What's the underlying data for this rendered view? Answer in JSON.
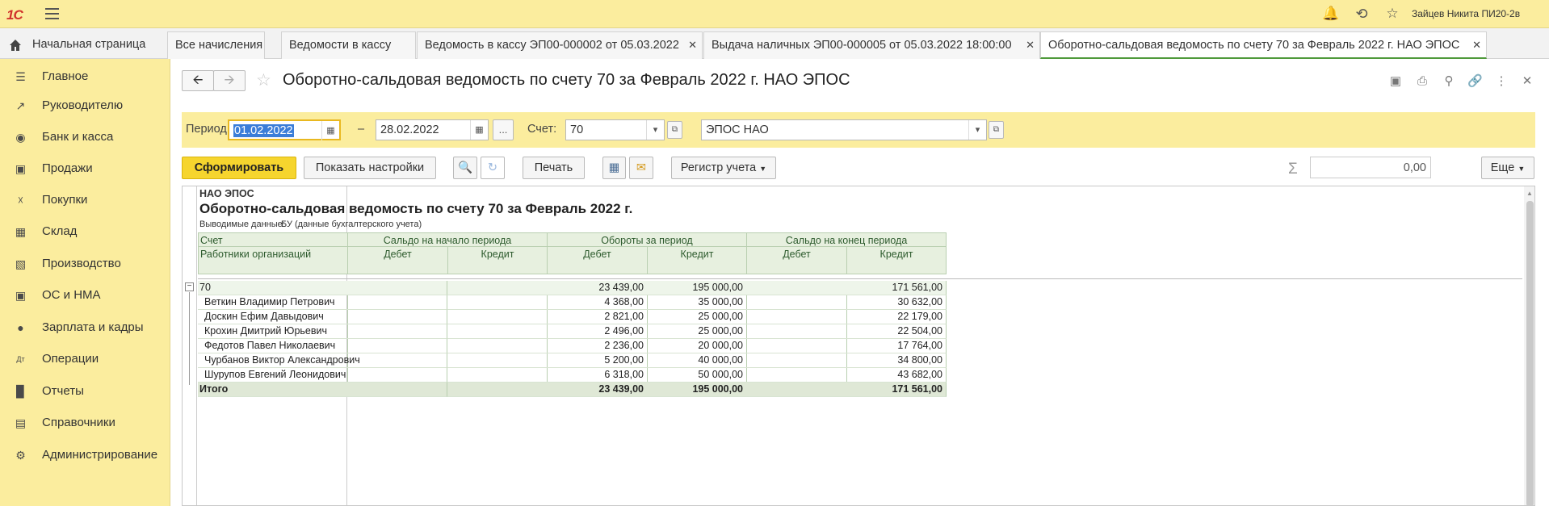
{
  "topbar": {
    "logo": "1С",
    "user_name": "Зайцев Никита ПИ20-2в",
    "icons": [
      "bell-icon",
      "history-icon",
      "star-icon"
    ]
  },
  "tabs": {
    "home": "Начальная страница",
    "items": [
      {
        "label": "Все начисления",
        "closable": false
      },
      {
        "label": "Ведомости в кассу",
        "closable": false
      },
      {
        "label": "Ведомость в кассу ЭП00-000002 от 05.03.2022",
        "closable": true
      },
      {
        "label": "Выдача наличных ЭП00-000005 от 05.03.2022 18:00:00",
        "closable": true
      },
      {
        "label": "Оборотно-сальдовая ведомость по счету 70 за Февраль 2022 г. НАО ЭПОС",
        "closable": true,
        "active": true
      }
    ]
  },
  "sidebar": {
    "items": [
      {
        "label": "Главное",
        "icon": "menu-lines-icon"
      },
      {
        "label": "Руководителю",
        "icon": "trend-icon"
      },
      {
        "label": "Банк и касса",
        "icon": "coin-icon"
      },
      {
        "label": "Продажи",
        "icon": "bag-icon"
      },
      {
        "label": "Покупки",
        "icon": "cart-icon"
      },
      {
        "label": "Склад",
        "icon": "warehouse-icon"
      },
      {
        "label": "Производство",
        "icon": "factory-icon"
      },
      {
        "label": "ОС и НМА",
        "icon": "truck-icon"
      },
      {
        "label": "Зарплата и кадры",
        "icon": "person-icon"
      },
      {
        "label": "Операции",
        "icon": "dt-kt-icon"
      },
      {
        "label": "Отчеты",
        "icon": "bar-chart-icon"
      },
      {
        "label": "Справочники",
        "icon": "books-icon"
      },
      {
        "label": "Администрирование",
        "icon": "gear-icon"
      }
    ]
  },
  "form": {
    "title": "Оборотно-сальдовая ведомость по счету 70 за Февраль 2022 г. НАО ЭПОС",
    "filters": {
      "period_label": "Период:",
      "period_start": "01.02.2022",
      "period_dash": "–",
      "period_end": "28.02.2022",
      "ellipsis": "...",
      "account_label": "Счет:",
      "account_value": "70",
      "organization": "ЭПОС НАО"
    },
    "toolbar": {
      "generate": "Сформировать",
      "show_settings": "Показать настройки",
      "print": "Печать",
      "register": "Регистр учета",
      "sum_value": "0,00",
      "more": "Еще"
    }
  },
  "report": {
    "org": "НАО ЭПОС",
    "title": "Оборотно-сальдовая ведомость по счету 70 за Февраль 2022 г.",
    "output_label": "Выводимые данные:",
    "output_value": "БУ (данные бухгалтерского учета)",
    "headers": {
      "account": "Счет",
      "subconto": "Работники организаций",
      "opening": "Сальдо на начало периода",
      "turnover": "Обороты за период",
      "closing": "Сальдо на конец периода",
      "debit": "Дебет",
      "credit": "Кредит"
    },
    "group": {
      "name": "70",
      "open_debit": "",
      "open_credit": "",
      "turn_debit": "23 439,00",
      "turn_credit": "195 000,00",
      "close_debit": "",
      "close_credit": "171 561,00"
    },
    "rows": [
      {
        "name": "Веткин Владимир Петрович",
        "turn_debit": "4 368,00",
        "turn_credit": "35 000,00",
        "close_credit": "30 632,00"
      },
      {
        "name": "Доскин Ефим Давыдович",
        "turn_debit": "2 821,00",
        "turn_credit": "25 000,00",
        "close_credit": "22 179,00"
      },
      {
        "name": "Крохин Дмитрий Юрьевич",
        "turn_debit": "2 496,00",
        "turn_credit": "25 000,00",
        "close_credit": "22 504,00"
      },
      {
        "name": "Федотов Павел Николаевич",
        "turn_debit": "2 236,00",
        "turn_credit": "20 000,00",
        "close_credit": "17 764,00"
      },
      {
        "name": "Чурбанов Виктор Александрович",
        "turn_debit": "5 200,00",
        "turn_credit": "40 000,00",
        "close_credit": "34 800,00"
      },
      {
        "name": "Шурупов Евгений Леонидович",
        "turn_debit": "6 318,00",
        "turn_credit": "50 000,00",
        "close_credit": "43 682,00"
      }
    ],
    "total": {
      "name": "Итого",
      "turn_debit": "23 439,00",
      "turn_credit": "195 000,00",
      "close_credit": "171 561,00"
    }
  }
}
